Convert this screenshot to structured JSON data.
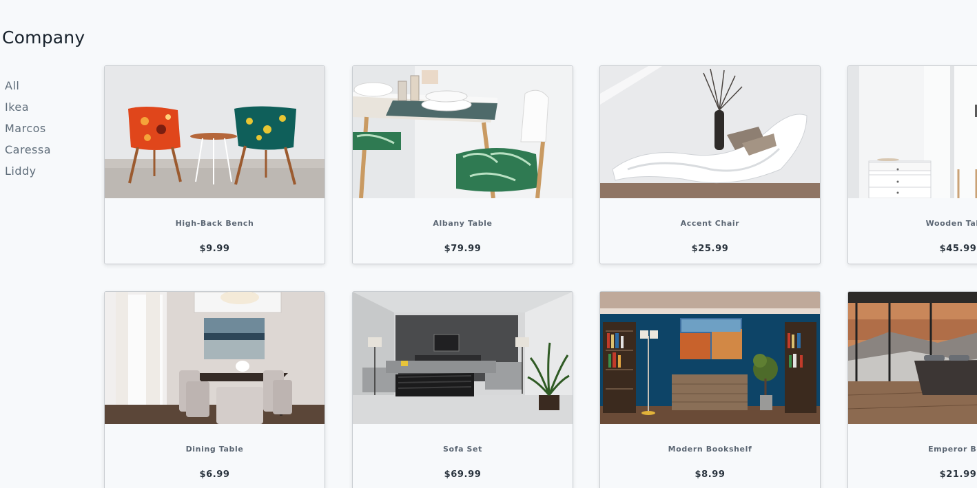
{
  "header": {
    "title": "Company"
  },
  "filters": [
    "All",
    "Ikea",
    "Marcos",
    "Caressa",
    "Liddy"
  ],
  "products": [
    {
      "name": "High-Back Bench",
      "price": "$9.99"
    },
    {
      "name": "Albany Table",
      "price": "$79.99"
    },
    {
      "name": "Accent Chair",
      "price": "$25.99"
    },
    {
      "name": "Wooden Table",
      "price": "$45.99"
    },
    {
      "name": "Dining Table",
      "price": "$6.99"
    },
    {
      "name": "Sofa Set",
      "price": "$69.99"
    },
    {
      "name": "Modern Bookshelf",
      "price": "$8.99"
    },
    {
      "name": "Emperor Bed",
      "price": "$21.99"
    }
  ]
}
